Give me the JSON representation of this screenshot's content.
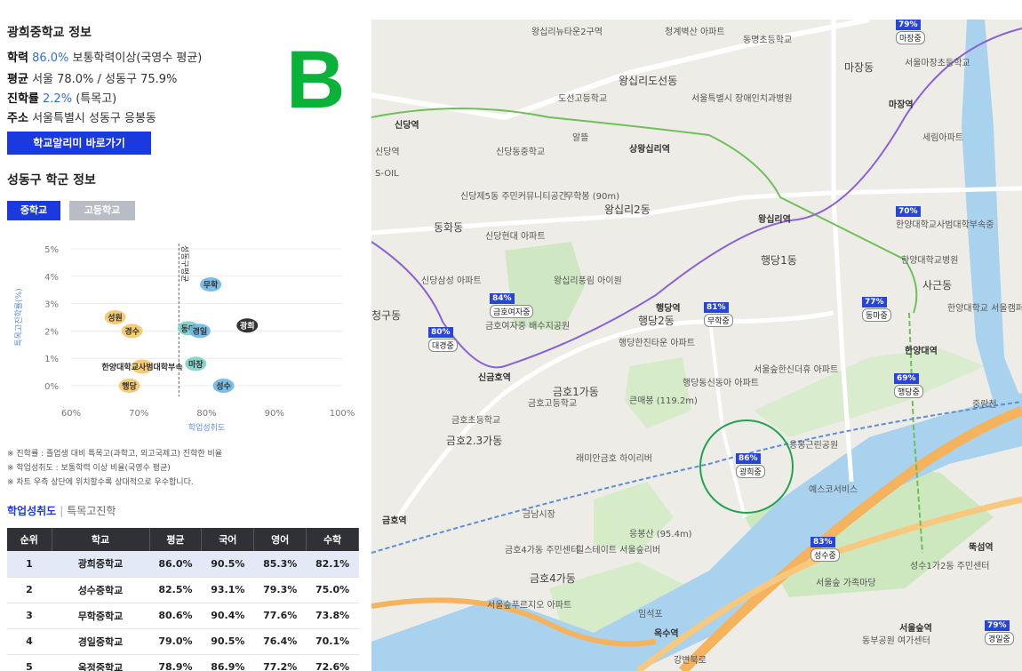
{
  "school": {
    "title": "광희중학교 정보",
    "academic_label": "학력",
    "academic_value": "86.0%",
    "academic_desc": "보통학력이상(국영수 평균)",
    "avg_label": "평균",
    "avg_value": "서울 78.0% / 성동구 75.9%",
    "advance_label": "진학률",
    "advance_value": "2.2%",
    "advance_desc": "(특목고)",
    "address_label": "주소",
    "address_value": "서울특별시 성동구 응봉동",
    "button_label": "학교알리미 바로가기",
    "marker": "B"
  },
  "district": {
    "title": "성동구 학군 정보",
    "tabs": [
      "중학교",
      "고등학교"
    ]
  },
  "chart_data": {
    "type": "scatter",
    "xlabel": "학업성취도",
    "ylabel": "특목고진학률(%)",
    "x_ticks": [
      "60%",
      "70%",
      "80%",
      "90%",
      "100%"
    ],
    "y_ticks": [
      "0%",
      "1%",
      "2%",
      "3%",
      "4%",
      "5%"
    ],
    "xlim": [
      60,
      100
    ],
    "ylim": [
      0,
      5
    ],
    "avg_line_x": 75.9,
    "avg_line_label": "성동구평균",
    "points": [
      {
        "name": "무학",
        "x": 80.6,
        "y": 3.7,
        "color": "#6cb8e6"
      },
      {
        "name": "성원",
        "x": 66.5,
        "y": 2.5,
        "color": "#f3c86a"
      },
      {
        "name": "경수",
        "x": 69.0,
        "y": 2.0,
        "color": "#f3c86a"
      },
      {
        "name": "동마",
        "x": 77.3,
        "y": 2.1,
        "color": "#7fd1c9"
      },
      {
        "name": "경일",
        "x": 79.0,
        "y": 2.0,
        "color": "#6cb8e6"
      },
      {
        "name": "광희",
        "x": 86.0,
        "y": 2.2,
        "color": "#222222"
      },
      {
        "name": "한양대학교사범대학부속",
        "x": 70.5,
        "y": 0.7,
        "color": "#f3c86a"
      },
      {
        "name": "마장",
        "x": 78.4,
        "y": 0.8,
        "color": "#7fd1c9"
      },
      {
        "name": "행당",
        "x": 68.6,
        "y": 0.0,
        "color": "#f3c86a"
      },
      {
        "name": "성수",
        "x": 82.5,
        "y": 0.0,
        "color": "#6cb8e6"
      }
    ]
  },
  "notes": [
    "※ 진학률 : 졸업생 대비 특목고(과학고, 외고국제고) 진학한 비율",
    "※ 학업성취도 : 보통학력 이상 비율(국영수 평균)",
    "※ 차트 우측 상단에 위치할수록 상대적으로 우수합니다."
  ],
  "links": {
    "first": "학업성취도",
    "second": "특목고진학"
  },
  "table": {
    "headers": [
      "순위",
      "학교",
      "평균",
      "국어",
      "영어",
      "수학"
    ],
    "rows": [
      [
        "1",
        "광희중학교",
        "86.0%",
        "90.5%",
        "85.3%",
        "82.1%"
      ],
      [
        "2",
        "성수중학교",
        "82.5%",
        "93.1%",
        "79.3%",
        "75.0%"
      ],
      [
        "3",
        "무학중학교",
        "80.6%",
        "90.4%",
        "77.6%",
        "73.8%"
      ],
      [
        "4",
        "경일중학교",
        "79.0%",
        "90.5%",
        "76.4%",
        "70.1%"
      ],
      [
        "5",
        "옥정중학교",
        "78.9%",
        "86.9%",
        "77.2%",
        "72.6%"
      ]
    ]
  },
  "map": {
    "area_labels": [
      "동화동",
      "왕십리2동",
      "행당1동",
      "행당2동",
      "사근동",
      "금호1가동",
      "금호2.3가동",
      "금호4가동",
      "청구동",
      "마장동",
      "왕십리도선동"
    ],
    "stations": [
      "신당역",
      "상왕십리역",
      "왕십리역",
      "행당역",
      "신금호역",
      "한양대역",
      "마장역",
      "금호역",
      "옥수역",
      "서울숲역",
      "뚝섬역"
    ],
    "places": [
      "왕십리뉴타운2구역",
      "청계벽산 아파트",
      "동명초등학교",
      "서울마장초등학교",
      "도선고등학교",
      "서울특별시 장애인치과병원",
      "신당동중학교",
      "무학봉 (90m)",
      "신당제5동 주민커뮤니티공간",
      "신당현대 아파트",
      "신당삼성 아파트",
      "왕십리풍림 아이원",
      "금호여자중 배수지공원",
      "행당한진타운 아파트",
      "큰매봉 (119.2m)",
      "금호고등학교",
      "금호초등학교",
      "래미안금호 하이리버",
      "금남시장",
      "응봉산 (95.4m)",
      "금호4가동 주민센터",
      "힐스테이트 서울숲리버",
      "서울숲푸르지오 아파트",
      "서울숲한신더휴 아파트",
      "행당동신동아 아파트",
      "응봉근린공원",
      "예스코서비스",
      "서울숲 가족마당",
      "동부공원 여가센터",
      "한양대학교병원",
      "한양대학교 서울캠퍼스",
      "세림아파트",
      "성수1가2동 주민센터",
      "신당역",
      "알뜰",
      "S-OIL",
      "중랑천",
      "강변북로",
      "임석포",
      "한양대학교사범대학부속중"
    ],
    "school_flags": [
      {
        "pct": "79%",
        "name": "마장중"
      },
      {
        "pct": "70%",
        "name": "한양대학교사범대학부속중"
      },
      {
        "pct": "84%",
        "name": "금호여자중"
      },
      {
        "pct": "81%",
        "name": "무학중"
      },
      {
        "pct": "80%",
        "name": "대경중"
      },
      {
        "pct": "77%",
        "name": "동마중"
      },
      {
        "pct": "69%",
        "name": "행당중"
      },
      {
        "pct": "86%",
        "name": "광희중"
      },
      {
        "pct": "83%",
        "name": "성수중"
      },
      {
        "pct": "79%",
        "name": "경일중"
      }
    ]
  }
}
